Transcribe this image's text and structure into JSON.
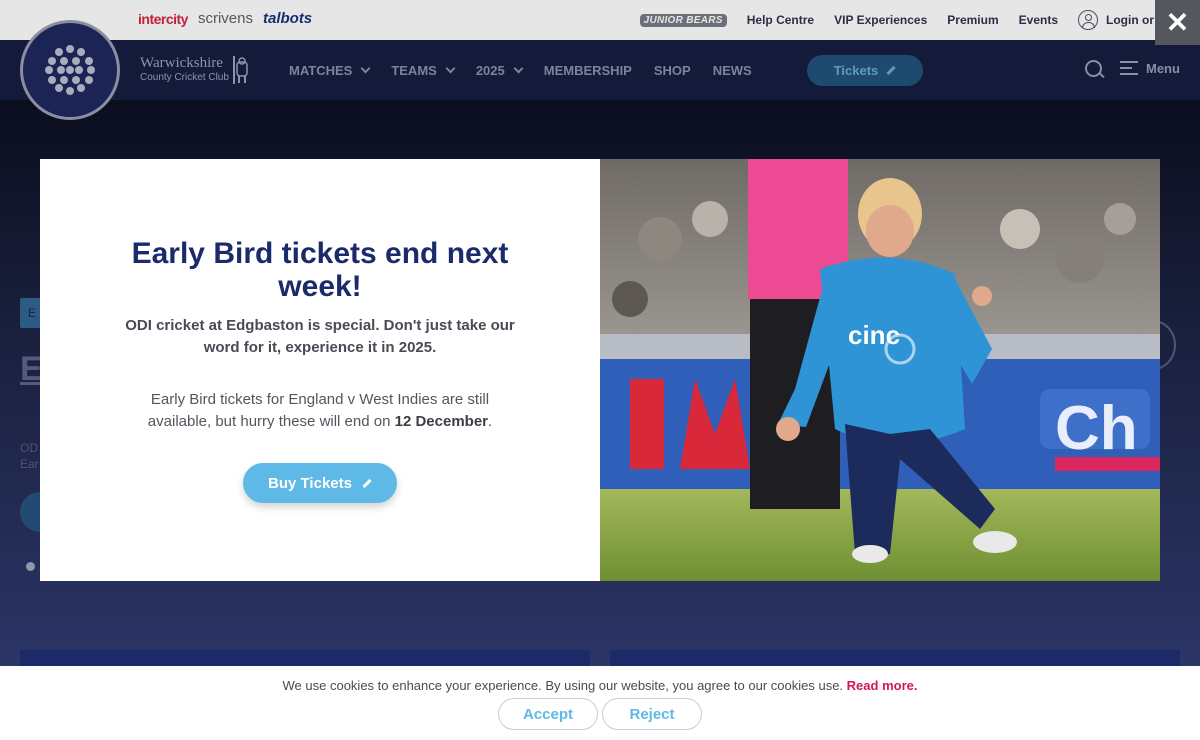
{
  "sponsors": [
    "intercity",
    "scrivens",
    "talbots"
  ],
  "utility_nav": {
    "junior_bears": "JUNIOR BEARS",
    "help_centre": "Help Centre",
    "vip_experiences": "VIP Experiences",
    "premium": "Premium",
    "events": "Events",
    "login": "Login or Regis"
  },
  "club": {
    "name_line1": "Warwickshire",
    "name_line2": "County Cricket Club"
  },
  "main_nav": {
    "items": [
      {
        "label": "MATCHES",
        "has_dropdown": true
      },
      {
        "label": "TEAMS",
        "has_dropdown": true
      },
      {
        "label": "2025",
        "has_dropdown": true
      },
      {
        "label": "MEMBERSHIP",
        "has_dropdown": false
      },
      {
        "label": "SHOP",
        "has_dropdown": false
      },
      {
        "label": "NEWS",
        "has_dropdown": false
      }
    ],
    "tickets_label": "Tickets",
    "menu_label": "Menu"
  },
  "hero": {
    "tag": "E",
    "title": "Ea ti",
    "sub_line1": "OD",
    "sub_line2": "Ear"
  },
  "modal": {
    "title": "Early Bird tickets end next week!",
    "lead": "ODI cricket at Edgbaston is special. Don't just take our word for it, experience it in 2025.",
    "body_prefix": "Early Bird tickets for England v West Indies are still available, but hurry these will end on ",
    "body_date": "12 December",
    "body_suffix": ".",
    "cta_label": "Buy Tickets",
    "photo_alt": "England cricketer celebrating on one knee"
  },
  "close_label": "✕",
  "cookie": {
    "text": "We use cookies to enhance your experience. By using our website, you agree to our cookies use.",
    "link": "Read more.",
    "accept": "Accept",
    "reject": "Reject"
  },
  "colors": {
    "navy": "#141a3a",
    "title_blue": "#1b2a6b",
    "cta_blue": "#5fb9e6",
    "cookie_link_pink": "#d2155e"
  }
}
